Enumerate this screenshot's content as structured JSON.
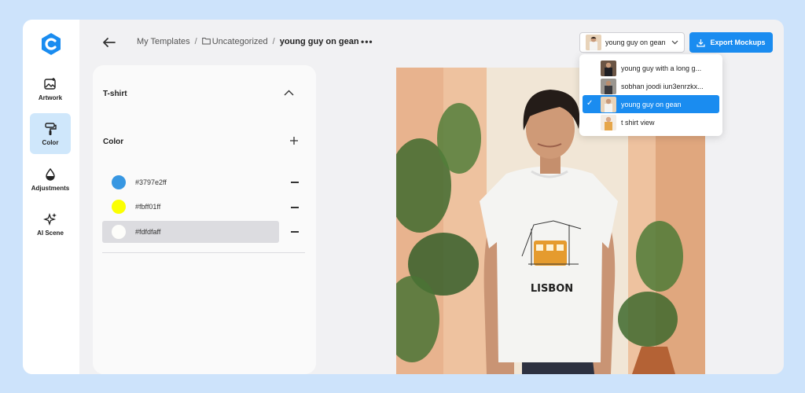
{
  "rail": {
    "items": [
      {
        "label": "Artwork",
        "icon": "artwork-icon"
      },
      {
        "label": "Color",
        "icon": "paint-roller-icon"
      },
      {
        "label": "Adjustments",
        "icon": "droplet-icon"
      },
      {
        "label": "AI Scene",
        "icon": "sparkles-icon"
      }
    ],
    "active_color": "#cfe7fb"
  },
  "header": {
    "breadcrumb": {
      "root": "My Templates",
      "folder": "Uncategorized",
      "current": "young guy on gean"
    },
    "more_label": "•••",
    "selector_value": "young guy on gean",
    "export_label": "Export Mockups",
    "accent": "#1a8cf0"
  },
  "panel": {
    "title": "T-shirt",
    "color_section": "Color",
    "colors": [
      {
        "hex": "#3797e2ff",
        "swatch": "#3797e2"
      },
      {
        "hex": "#fbff01ff",
        "swatch": "#fbff01"
      },
      {
        "hex": "#fdfdfaff",
        "swatch": "#fdfdfa"
      }
    ],
    "selected_color_index": 2
  },
  "dropdown": {
    "options": [
      "young guy with a long g...",
      "sobhan joodi iun3enrzkx...",
      "young guy on gean",
      "t shirt view"
    ],
    "selected_index": 2,
    "check": "✓"
  },
  "mockup": {
    "print_text": "LISBON"
  }
}
